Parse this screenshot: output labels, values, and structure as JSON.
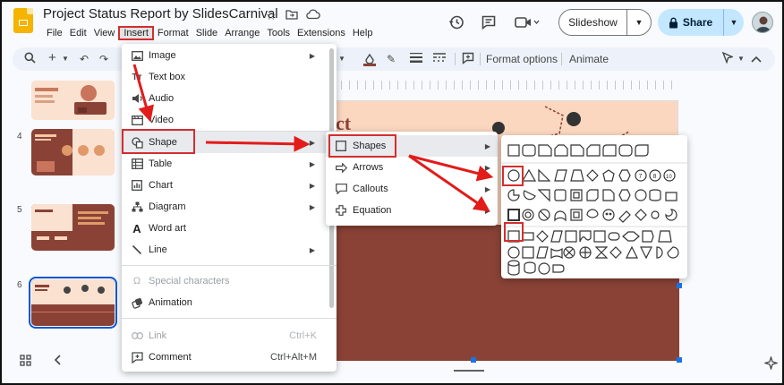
{
  "app": {
    "doc_title": "Project Status Report by SlidesCarnival"
  },
  "menubar": [
    "File",
    "Edit",
    "View",
    "Insert",
    "Format",
    "Slide",
    "Arrange",
    "Tools",
    "Extensions",
    "Help"
  ],
  "header": {
    "slideshow_label": "Slideshow",
    "share_label": "Share"
  },
  "toolbar": {
    "format_options": "Format options",
    "animate": "Animate"
  },
  "filmstrip": {
    "slide_numbers": [
      "4",
      "5",
      "6"
    ]
  },
  "insert_menu": {
    "items": [
      {
        "label": "Image",
        "icon": "image-icon",
        "submenu": true
      },
      {
        "label": "Text box",
        "icon": "text-box-icon"
      },
      {
        "label": "Audio",
        "icon": "audio-icon"
      },
      {
        "label": "Video",
        "icon": "video-icon"
      },
      {
        "label": "Shape",
        "icon": "shape-icon",
        "submenu": true
      },
      {
        "label": "Table",
        "icon": "table-icon",
        "submenu": true
      },
      {
        "label": "Chart",
        "icon": "chart-icon",
        "submenu": true
      },
      {
        "label": "Diagram",
        "icon": "diagram-icon",
        "submenu": true
      },
      {
        "label": "Word art",
        "icon": "word-art-icon"
      },
      {
        "label": "Line",
        "icon": "line-icon",
        "submenu": true
      },
      {
        "label": "Special characters",
        "icon": "omega-icon",
        "disabled": true
      },
      {
        "label": "Animation",
        "icon": "animation-icon"
      },
      {
        "label": "Link",
        "icon": "link-icon",
        "disabled": true,
        "shortcut": "Ctrl+K"
      },
      {
        "label": "Comment",
        "icon": "comment-icon",
        "shortcut": "Ctrl+Alt+M"
      }
    ]
  },
  "shape_submenu": {
    "items": [
      {
        "label": "Shapes",
        "icon": "square-icon"
      },
      {
        "label": "Arrows",
        "icon": "arrow-icon"
      },
      {
        "label": "Callouts",
        "icon": "callout-icon"
      },
      {
        "label": "Equation",
        "icon": "equation-icon"
      }
    ]
  },
  "colors": {
    "accent_red": "#d32f2f",
    "slide_band": "#8a4236",
    "slide_bg": "#fbd7c0",
    "share_bg": "#c2e7ff"
  }
}
